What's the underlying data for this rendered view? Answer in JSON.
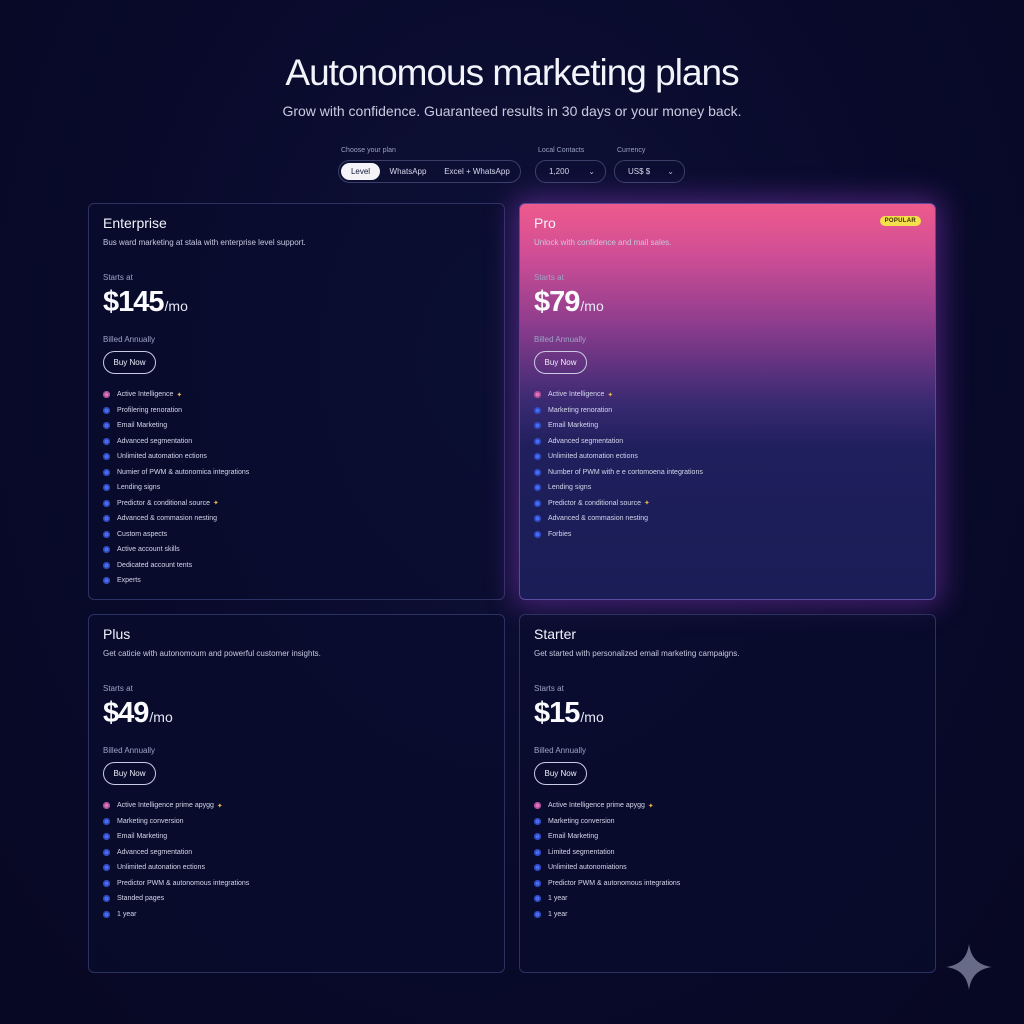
{
  "header": {
    "title": "Autonomous marketing plans",
    "subtitle": "Grow with confidence. Guaranteed results in 30 days or your money back."
  },
  "controls": {
    "plan_label": "Choose your plan",
    "plan_options": [
      "Level",
      "WhatsApp",
      "Excel + WhatsApp"
    ],
    "plan_selected": "Level",
    "contacts_label": "Local Contacts",
    "contacts_value": "1,200",
    "currency_label": "Currency",
    "currency_value": "US$ $"
  },
  "plans": [
    {
      "name": "Enterprise",
      "description": "Bus ward marketing at stala with enterprise level support.",
      "starts_at": "Starts at",
      "price": "$145",
      "period": "/mo",
      "billed": "Billed Annually",
      "cta": "Buy Now",
      "features": [
        "Active Intelligence",
        "Profilering renoration",
        "Email Marketing",
        "Advanced segmentation",
        "Unlimited automation ections",
        "Numier of PWM & autonomica integrations",
        "Lending signs",
        "Predictor & conditional source",
        "Advanced & commasion nesting",
        "Custom aspects",
        "Active account skills",
        "Dedicated account tents",
        "Experts"
      ]
    },
    {
      "name": "Pro",
      "badge": "POPULAR",
      "description": "Unlock with confidence and mail sales.",
      "starts_at": "Starts at",
      "price": "$79",
      "period": "/mo",
      "billed": "Billed Annually",
      "cta": "Buy Now",
      "features": [
        "Active Intelligence",
        "Marketing renoration",
        "Email Marketing",
        "Advanced segmentation",
        "Unlimited automation ections",
        "Number of PWM with e e cortomoena integrations",
        "Lending signs",
        "Predictor & conditional source",
        "Advanced & commasion nesting",
        "Forbies"
      ]
    },
    {
      "name": "Plus",
      "description": "Get caticie with autonomoum and powerful customer insights.",
      "starts_at": "Starts at",
      "price": "$49",
      "period": "/mo",
      "billed": "Billed Annually",
      "cta": "Buy Now",
      "features": [
        "Active Intelligence prime apygg",
        "Marketing conversion",
        "Email Marketing",
        "Advanced segmentation",
        "Unlimited autonation ections",
        "Predictor PWM & autonomous integrations",
        "Standed pages",
        "1 year"
      ]
    },
    {
      "name": "Starter",
      "description": "Get started with personalized email marketing campaigns.",
      "starts_at": "Starts at",
      "price": "$15",
      "period": "/mo",
      "billed": "Billed Annually",
      "cta": "Buy Now",
      "features": [
        "Active Intelligence prime apygg",
        "Marketing conversion",
        "Email Marketing",
        "Limited segmentation",
        "Unlimited autonomiations",
        "Predictor PWM & autonomous integrations",
        "1 year",
        "1 year"
      ]
    }
  ],
  "icons": {
    "feature_dot": "check-dot-icon",
    "sparkle": "sparkle-icon",
    "corner": "star-sparkle-icon"
  },
  "colors": {
    "background": "#090a2b",
    "accent_blue": "#4a6cf0",
    "accent_pink": "#e270c0",
    "badge_yellow": "#f4e04a"
  }
}
